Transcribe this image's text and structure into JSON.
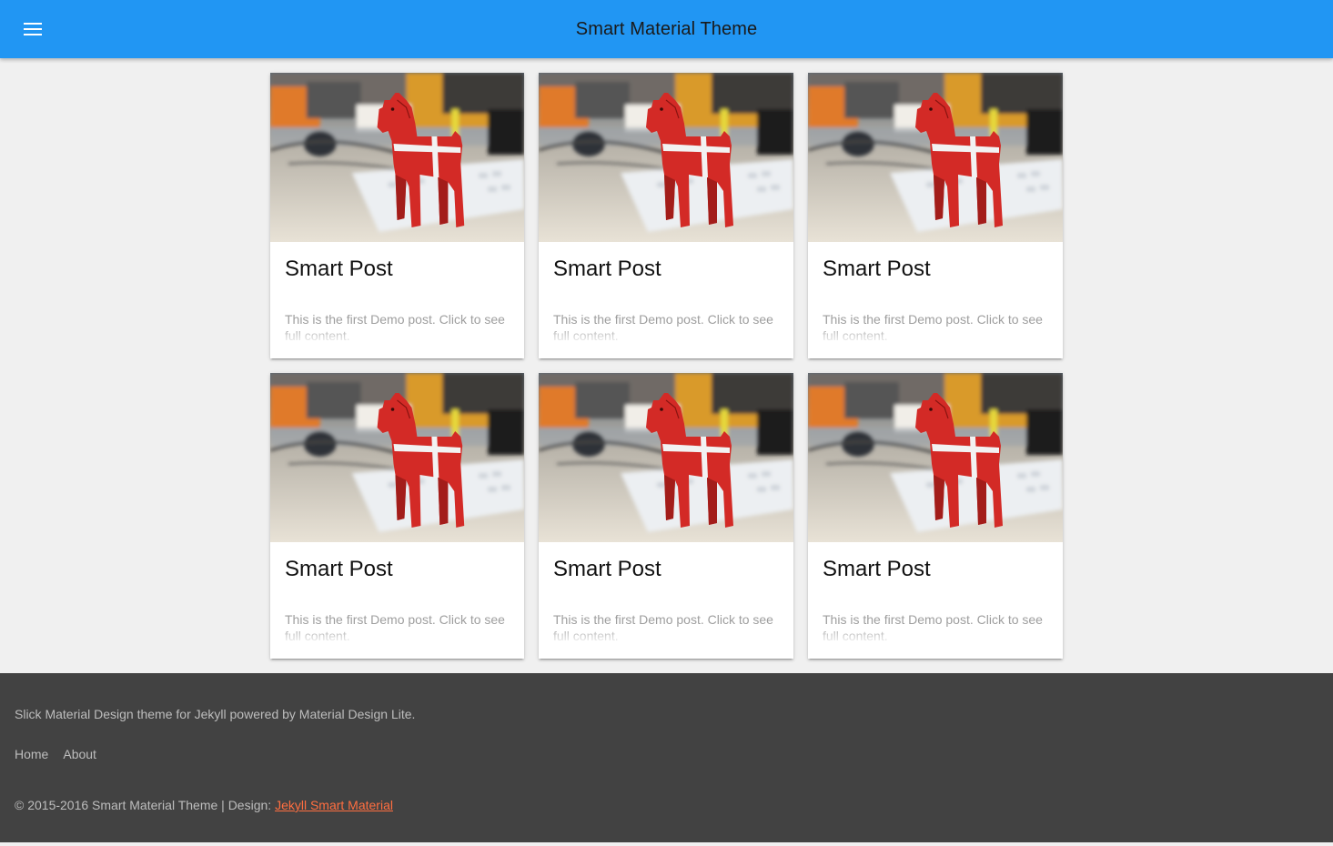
{
  "header": {
    "title": "Smart Material Theme",
    "menu_icon": "menu-icon"
  },
  "posts": [
    {
      "title": "Smart Post",
      "excerpt": "This is the first Demo post. Click to see full content.",
      "image": "red-dala-horse-photo"
    },
    {
      "title": "Smart Post",
      "excerpt": "This is the first Demo post. Click to see full content.",
      "image": "red-dala-horse-photo"
    },
    {
      "title": "Smart Post",
      "excerpt": "This is the first Demo post. Click to see full content.",
      "image": "red-dala-horse-photo"
    },
    {
      "title": "Smart Post",
      "excerpt": "This is the first Demo post. Click to see full content.",
      "image": "red-dala-horse-photo"
    },
    {
      "title": "Smart Post",
      "excerpt": "This is the first Demo post. Click to see full content.",
      "image": "red-dala-horse-photo"
    },
    {
      "title": "Smart Post",
      "excerpt": "This is the first Demo post. Click to see full content.",
      "image": "red-dala-horse-photo"
    }
  ],
  "footer": {
    "description": "Slick Material Design theme for Jekyll powered by Material Design Lite.",
    "links": [
      "Home",
      "About"
    ],
    "copyright": "© 2015-2016 Smart Material Theme | Design: ",
    "design_link": "Jekyll Smart Material"
  },
  "colors": {
    "header": "#2196f3",
    "background": "#f0f0f0",
    "footer": "#424242",
    "link_accent": "#ff6e40"
  }
}
